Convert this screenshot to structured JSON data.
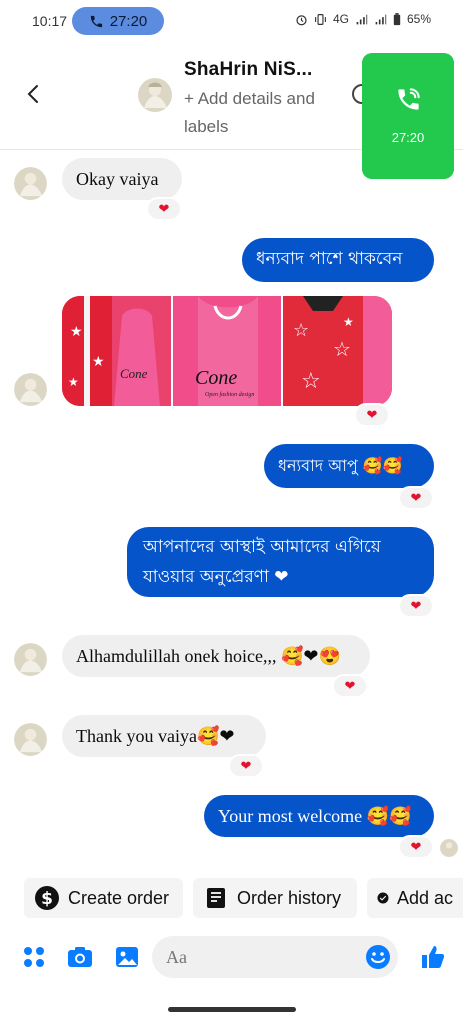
{
  "status_bar": {
    "time": "10:17",
    "call_timer": "27:20",
    "network": "4G",
    "battery": "65%"
  },
  "header": {
    "contact_name": "ShaHrin NiS...",
    "add_details": "+ Add details and labels",
    "call_overlay_timer": "27:20"
  },
  "messages": [
    {
      "side": "in",
      "text": "Okay vaiya",
      "reaction": "❤"
    },
    {
      "side": "out",
      "text": "ধন্যবাদ পাশে থাকবেন"
    },
    {
      "side": "in",
      "type": "images",
      "reaction": "❤",
      "image_text": "Cone",
      "image_subtext": "Open fashion design"
    },
    {
      "side": "out",
      "text": "ধন্যবাদ আপু 🥰🥰",
      "reaction": "❤"
    },
    {
      "side": "out",
      "text": "আপনাদের আস্থাই আমাদের এগিয়ে যাওয়ার অনুপ্রেরণা ❤",
      "reaction": "❤"
    },
    {
      "side": "in",
      "text": "Alhamdulillah onek hoice,,, 🥰❤😍",
      "reaction": "❤"
    },
    {
      "side": "in",
      "text": "Thank you vaiya🥰❤",
      "reaction": "❤"
    },
    {
      "side": "out",
      "text": "Your most welcome 🥰🥰",
      "reaction": "❤"
    }
  ],
  "quick_actions": {
    "create_order": "Create order",
    "order_history": "Order history",
    "add_more": "Add ac"
  },
  "composer": {
    "placeholder": "Aa"
  },
  "colors": {
    "accent": "#0654c9",
    "call_green": "#22c94c",
    "heart": "#e3122e"
  }
}
